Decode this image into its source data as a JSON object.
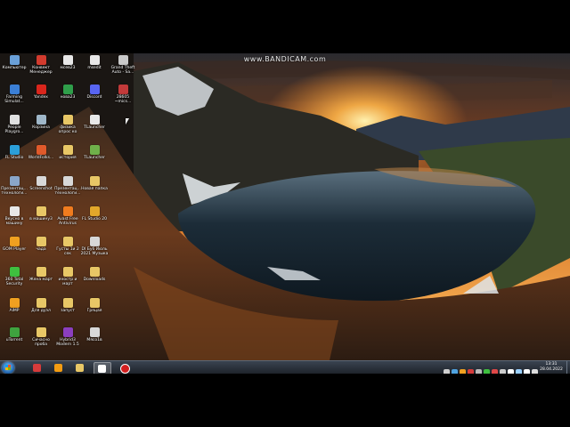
{
  "watermark": "www.BANDICAM.com",
  "desktop_icons": [
    {
      "label": "Компьютер",
      "icon": "computer-icon",
      "color": "#6aa0d8"
    },
    {
      "label": "Конвект Менеджер",
      "icon": "app-icon",
      "color": "#d23b2e"
    },
    {
      "label": "мсев23",
      "icon": "file-icon",
      "color": "#e8e8e8"
    },
    {
      "label": "msedit",
      "icon": "file-icon",
      "color": "#e8e8e8"
    },
    {
      "label": "Grand Theft Auto - Sa...",
      "icon": "game-icon",
      "color": "#c9c9c9"
    },
    {
      "label": "Farming Simulat...",
      "icon": "game-icon",
      "color": "#3b7fd6"
    },
    {
      "label": "Yandex",
      "icon": "yandex-icon",
      "color": "#d9261c"
    },
    {
      "label": "нова23",
      "icon": "file-icon",
      "color": "#2f9e4a"
    },
    {
      "label": "Discord",
      "icon": "discord-icon",
      "color": "#5865f2"
    },
    {
      "label": "28605 ~mics...",
      "icon": "flag-icon",
      "color": "#c23a3a"
    },
    {
      "label": "People Playgro...",
      "icon": "game-icon",
      "color": "#e0e0e0"
    },
    {
      "label": "Корзина",
      "icon": "recycle-bin-icon",
      "color": "#9fb7c9"
    },
    {
      "label": "физика опрос ко",
      "icon": "folder-icon",
      "color": "#e8c766"
    },
    {
      "label": "TLauncher",
      "icon": "minecraft-icon",
      "color": "#e8e8e8"
    },
    {
      "label": "FL Studio",
      "icon": "fl-studio-icon",
      "color": "#2b9fd9"
    },
    {
      "label": "WorldFolks...",
      "icon": "app-icon",
      "color": "#e05a2b"
    },
    {
      "label": "история",
      "icon": "folder-icon",
      "color": "#e8c766"
    },
    {
      "label": "TLauncher",
      "icon": "minecraft-icon",
      "color": "#6fb04a"
    },
    {
      "label": "Презентац... технологи...",
      "icon": "file-icon",
      "color": "#8aa6c9"
    },
    {
      "label": "Screenshot",
      "icon": "file-icon",
      "color": "#d8d8d8"
    },
    {
      "label": "Презентац... технологи...",
      "icon": "file-icon",
      "color": "#d8d8d8"
    },
    {
      "label": "Новая папка",
      "icon": "folder-icon",
      "color": "#e8c766"
    },
    {
      "label": "Вкусно в машину",
      "icon": "file-icon",
      "color": "#e8e8e8"
    },
    {
      "label": "в машину3",
      "icon": "folder-icon",
      "color": "#e8c766"
    },
    {
      "label": "Avast Free Antivirus",
      "icon": "avast-icon",
      "color": "#f07c1f"
    },
    {
      "label": "FL Studio 20",
      "icon": "fl-studio-icon",
      "color": "#e3a72a"
    },
    {
      "label": "GOM Player",
      "icon": "gom-player-icon",
      "color": "#f0a020"
    },
    {
      "label": "чада",
      "icon": "folder-icon",
      "color": "#e8c766"
    },
    {
      "label": "Густы 1и 2 сек",
      "icon": "folder-icon",
      "color": "#e8c766"
    },
    {
      "label": "DI Бу6 Июль 2021 Музыка",
      "icon": "file-icon",
      "color": "#d8d8d8"
    },
    {
      "label": "360 Total Security",
      "icon": "security-icon",
      "color": "#3fbf3f"
    },
    {
      "label": "Жена март",
      "icon": "folder-icon",
      "color": "#e8c766"
    },
    {
      "label": "иностр и март",
      "icon": "folder-icon",
      "color": "#e8c766"
    },
    {
      "label": "Downloads",
      "icon": "folder-icon",
      "color": "#e8c766"
    },
    {
      "label": "AIMP",
      "icon": "aimp-icon",
      "color": "#f0a020"
    },
    {
      "label": "Для дуэл",
      "icon": "folder-icon",
      "color": "#e8c766"
    },
    {
      "label": "запуст",
      "icon": "folder-icon",
      "color": "#e8c766"
    },
    {
      "label": "Гряцая",
      "icon": "folder-icon",
      "color": "#e8c766"
    },
    {
      "label": "uTorrent",
      "icon": "utorrent-icon",
      "color": "#3fa33f"
    },
    {
      "label": "Сичасно проба",
      "icon": "folder-icon",
      "color": "#e8c766"
    },
    {
      "label": "Hybrid3 Modern 1.5",
      "icon": "app-icon",
      "color": "#8b3fbf"
    },
    {
      "label": "Мясо1в",
      "icon": "file-icon",
      "color": "#d8d8d8"
    }
  ],
  "taskbar": {
    "start_label": "Start",
    "apps": [
      {
        "name": "bandicam",
        "icon": "bandicam-icon",
        "color": "#d63b3b",
        "active": false
      },
      {
        "name": "browser",
        "icon": "browser-icon",
        "color": "#f39c12",
        "active": false
      },
      {
        "name": "explorer",
        "icon": "folder-icon",
        "color": "#e8c766",
        "active": false
      },
      {
        "name": "yandex",
        "icon": "yandex-icon",
        "color": "#ffffff",
        "active": true
      },
      {
        "name": "record",
        "icon": "record-icon",
        "color": "#d31f1f",
        "active": false
      }
    ],
    "tray_colors": [
      "#cfcfcf",
      "#4fa3e0",
      "#f0a020",
      "#d63b3b",
      "#bbbbbb",
      "#3fbf3f",
      "#e04848",
      "#cccccc",
      "#ffffff",
      "#9ad0ff",
      "#ffffff",
      "#dddddd"
    ],
    "clock_time": "13:31",
    "clock_date": "28.04.2022"
  }
}
